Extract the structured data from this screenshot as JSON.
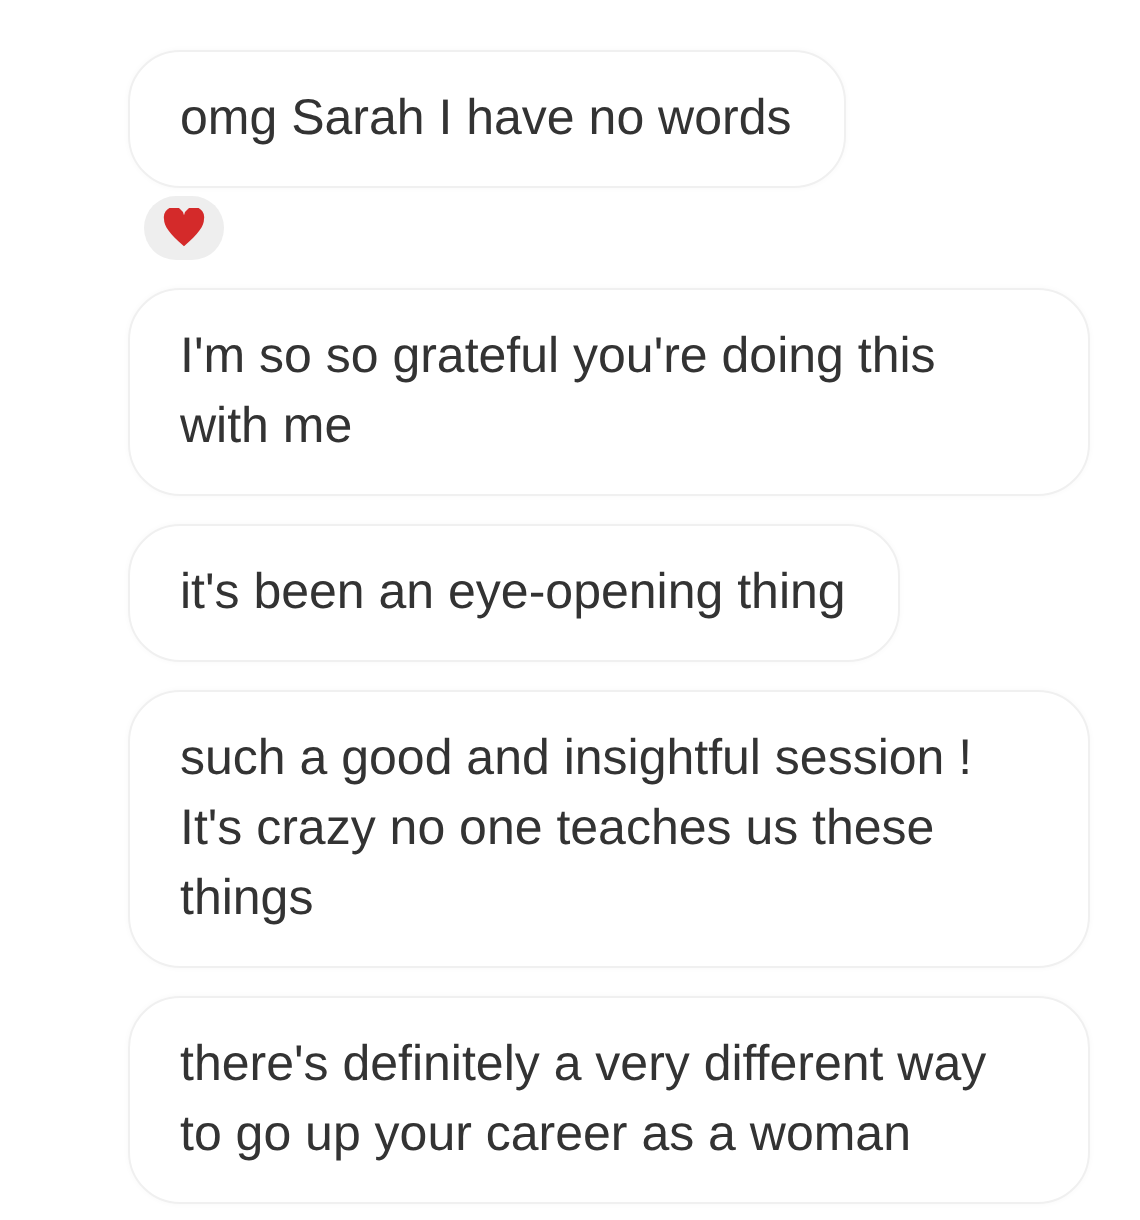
{
  "messages": [
    {
      "text": "omg Sarah I have no words",
      "reacted": true
    },
    {
      "text": "I'm so so grateful you're doing this with me",
      "reacted": false
    },
    {
      "text": "it's been an eye-opening thing",
      "reacted": false
    },
    {
      "text": "such a good and insightful session ! It's crazy no one teaches us these things",
      "reacted": false
    },
    {
      "text": "there's definitely a very different way to go up your career as a woman",
      "reacted": false
    }
  ]
}
